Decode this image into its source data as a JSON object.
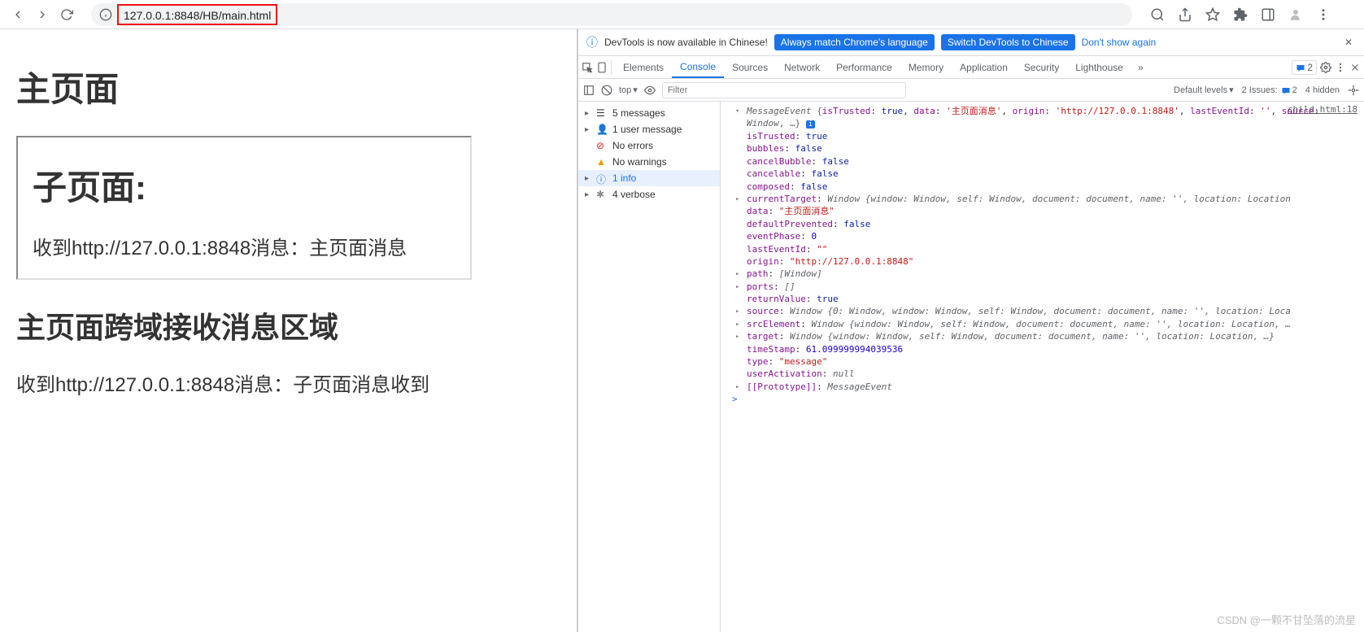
{
  "toolbar": {
    "url": "127.0.0.1:8848/HB/main.html"
  },
  "page": {
    "h1": "主页面",
    "child_h1": "子页面:",
    "child_msg": "收到http://127.0.0.1:8848消息：主页面消息",
    "section_h2": "主页面跨域接收消息区域",
    "section_msg": "收到http://127.0.0.1:8848消息：子页面消息收到"
  },
  "banner": {
    "info_icon": "ℹ",
    "text": "DevTools is now available in Chinese!",
    "btn1": "Always match Chrome's language",
    "btn2": "Switch DevTools to Chinese",
    "dont_show": "Don't show again"
  },
  "tabs": {
    "items": [
      "Elements",
      "Console",
      "Sources",
      "Network",
      "Performance",
      "Memory",
      "Application",
      "Security",
      "Lighthouse"
    ],
    "badge": "2"
  },
  "consoleToolbar": {
    "top": "top",
    "filter_ph": "Filter",
    "levels": "Default levels",
    "issues": "2 Issues:",
    "issues_badge": "2",
    "hidden": "4 hidden"
  },
  "sidebar": {
    "items": [
      {
        "label": "5 messages",
        "icon": "list",
        "expand": true
      },
      {
        "label": "1 user message",
        "icon": "user",
        "expand": true
      },
      {
        "label": "No errors",
        "icon": "error",
        "expand": false
      },
      {
        "label": "No warnings",
        "icon": "warn",
        "expand": false
      },
      {
        "label": "1 info",
        "icon": "info",
        "expand": true,
        "sel": true
      },
      {
        "label": "4 verbose",
        "icon": "verbose",
        "expand": true
      }
    ]
  },
  "console": {
    "source_link": "child.html:18",
    "header_pre": "MessageEvent ",
    "header_obj_open": "{",
    "header_parts": "isTrusted: true, data: '主页面消息', origin: 'http://127.0.0.1:8848', lastEventId: '', source: Window, …}",
    "lines": [
      {
        "tri": false,
        "prop": "isTrusted",
        "val": "true",
        "t": "bool"
      },
      {
        "tri": false,
        "prop": "bubbles",
        "val": "false",
        "t": "bool"
      },
      {
        "tri": false,
        "prop": "cancelBubble",
        "val": "false",
        "t": "bool"
      },
      {
        "tri": false,
        "prop": "cancelable",
        "val": "false",
        "t": "bool"
      },
      {
        "tri": false,
        "prop": "composed",
        "val": "false",
        "t": "bool"
      },
      {
        "tri": true,
        "prop": "currentTarget",
        "val": "Window {window: Window, self: Window, document: document, name: '', location: Location",
        "t": "obj"
      },
      {
        "tri": false,
        "prop": "data",
        "val": "\"主页面消息\"",
        "t": "str"
      },
      {
        "tri": false,
        "prop": "defaultPrevented",
        "val": "false",
        "t": "bool"
      },
      {
        "tri": false,
        "prop": "eventPhase",
        "val": "0",
        "t": "num"
      },
      {
        "tri": false,
        "prop": "lastEventId",
        "val": "\"\"",
        "t": "str"
      },
      {
        "tri": false,
        "prop": "origin",
        "val": "\"http://127.0.0.1:8848\"",
        "t": "str"
      },
      {
        "tri": true,
        "prop": "path",
        "val": "[Window]",
        "t": "obj"
      },
      {
        "tri": true,
        "prop": "ports",
        "val": "[]",
        "t": "obj"
      },
      {
        "tri": false,
        "prop": "returnValue",
        "val": "true",
        "t": "bool"
      },
      {
        "tri": true,
        "prop": "source",
        "val": "Window {0: Window, window: Window, self: Window, document: document, name: '', location: Loca",
        "t": "obj"
      },
      {
        "tri": true,
        "prop": "srcElement",
        "val": "Window {window: Window, self: Window, document: document, name: '', location: Location, …",
        "t": "obj"
      },
      {
        "tri": true,
        "prop": "target",
        "val": "Window {window: Window, self: Window, document: document, name: '', location: Location, …}",
        "t": "obj"
      },
      {
        "tri": false,
        "prop": "timeStamp",
        "val": "61.099999994039536",
        "t": "num"
      },
      {
        "tri": false,
        "prop": "type",
        "val": "\"message\"",
        "t": "str"
      },
      {
        "tri": false,
        "prop": "userActivation",
        "val": "null",
        "t": "obj"
      },
      {
        "tri": true,
        "prop": "[[Prototype]]",
        "val": "MessageEvent",
        "t": "obj"
      }
    ],
    "prompt": ">"
  },
  "watermark": "CSDN @一颗不甘坠落的流星"
}
